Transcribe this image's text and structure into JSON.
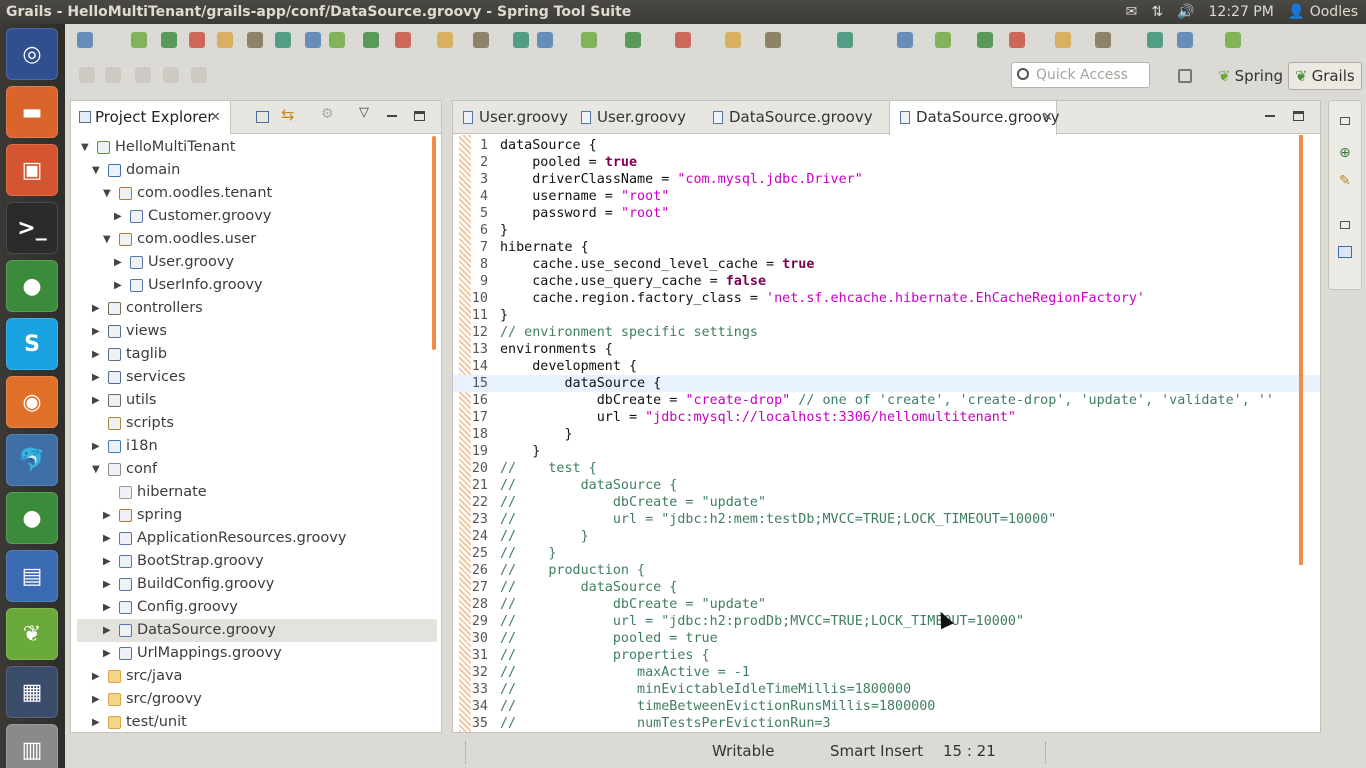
{
  "window": {
    "title": "Grails - HelloMultiTenant/grails-app/conf/DataSource.groovy - Spring Tool Suite"
  },
  "tray": {
    "time": "12:27 PM",
    "user": "Oodles"
  },
  "quick_access": {
    "placeholder": "Quick Access"
  },
  "perspectives": {
    "spring": "Spring",
    "grails": "Grails"
  },
  "project_explorer": {
    "title": "Project Explorer",
    "tree": [
      {
        "label": "HelloMultiTenant",
        "indent": 0,
        "twisty": "open",
        "icon": "project",
        "color": "#6a8f3a"
      },
      {
        "label": "domain",
        "indent": 1,
        "twisty": "open",
        "icon": "domain",
        "color": "#3d6fb0"
      },
      {
        "label": "com.oodles.tenant",
        "indent": 2,
        "twisty": "open",
        "icon": "package",
        "color": "#b07a2c"
      },
      {
        "label": "Customer.groovy",
        "indent": 3,
        "twisty": "closed",
        "icon": "file",
        "color": "#5677a6"
      },
      {
        "label": "com.oodles.user",
        "indent": 2,
        "twisty": "open",
        "icon": "package",
        "color": "#b07a2c"
      },
      {
        "label": "User.groovy",
        "indent": 3,
        "twisty": "closed",
        "icon": "file",
        "color": "#5677a6"
      },
      {
        "label": "UserInfo.groovy",
        "indent": 3,
        "twisty": "closed",
        "icon": "file",
        "color": "#5677a6"
      },
      {
        "label": "controllers",
        "indent": 1,
        "twisty": "closed",
        "icon": "controllers",
        "color": "#7a6b4e"
      },
      {
        "label": "views",
        "indent": 1,
        "twisty": "closed",
        "icon": "views",
        "color": "#5c6e86"
      },
      {
        "label": "taglib",
        "indent": 1,
        "twisty": "closed",
        "icon": "taglib",
        "color": "#5c6e86"
      },
      {
        "label": "services",
        "indent": 1,
        "twisty": "closed",
        "icon": "services",
        "color": "#4f6a8f"
      },
      {
        "label": "utils",
        "indent": 1,
        "twisty": "closed",
        "icon": "utils",
        "color": "#6b6b6b"
      },
      {
        "label": "scripts",
        "indent": 1,
        "twisty": "none",
        "icon": "scripts",
        "color": "#a08d3c"
      },
      {
        "label": "i18n",
        "indent": 1,
        "twisty": "closed",
        "icon": "globe",
        "color": "#3d7ab0"
      },
      {
        "label": "conf",
        "indent": 1,
        "twisty": "open",
        "icon": "conf",
        "color": "#8a8a8a"
      },
      {
        "label": "hibernate",
        "indent": 2,
        "twisty": "none",
        "icon": "package",
        "color": "#9a9a9a"
      },
      {
        "label": "spring",
        "indent": 2,
        "twisty": "closed",
        "icon": "package",
        "color": "#b07a2c"
      },
      {
        "label": "ApplicationResources.groovy",
        "indent": 2,
        "twisty": "closed",
        "icon": "file",
        "color": "#5677a6"
      },
      {
        "label": "BootStrap.groovy",
        "indent": 2,
        "twisty": "closed",
        "icon": "file",
        "color": "#5677a6"
      },
      {
        "label": "BuildConfig.groovy",
        "indent": 2,
        "twisty": "closed",
        "icon": "file",
        "color": "#5677a6"
      },
      {
        "label": "Config.groovy",
        "indent": 2,
        "twisty": "closed",
        "icon": "file",
        "color": "#5677a6"
      },
      {
        "label": "DataSource.groovy",
        "indent": 2,
        "twisty": "closed",
        "icon": "file",
        "color": "#5677a6",
        "selected": true
      },
      {
        "label": "UrlMappings.groovy",
        "indent": 2,
        "twisty": "closed",
        "icon": "file",
        "color": "#5677a6"
      },
      {
        "label": "src/java",
        "indent": 1,
        "twisty": "closed",
        "icon": "folder",
        "color": "#d9a441"
      },
      {
        "label": "src/groovy",
        "indent": 1,
        "twisty": "closed",
        "icon": "folder",
        "color": "#d9a441"
      },
      {
        "label": "test/unit",
        "indent": 1,
        "twisty": "closed",
        "icon": "folder",
        "color": "#d9a441"
      }
    ]
  },
  "editor": {
    "tabs": [
      {
        "label": "User.groovy",
        "active": false
      },
      {
        "label": "User.groovy",
        "active": false
      },
      {
        "label": "DataSource.groovy",
        "active": false
      },
      {
        "label": "DataSource.groovy",
        "active": true
      }
    ],
    "lines": [
      [
        {
          "t": "dataSource {",
          "c": "plain"
        }
      ],
      [
        {
          "t": "    pooled = ",
          "c": "plain"
        },
        {
          "t": "true",
          "c": "kw"
        }
      ],
      [
        {
          "t": "    driverClassName = ",
          "c": "plain"
        },
        {
          "t": "\"com.mysql.jdbc.Driver\"",
          "c": "str"
        }
      ],
      [
        {
          "t": "    username = ",
          "c": "plain"
        },
        {
          "t": "\"root\"",
          "c": "str"
        }
      ],
      [
        {
          "t": "    password = ",
          "c": "plain"
        },
        {
          "t": "\"root\"",
          "c": "str"
        }
      ],
      [
        {
          "t": "}",
          "c": "plain"
        }
      ],
      [
        {
          "t": "hibernate {",
          "c": "plain"
        }
      ],
      [
        {
          "t": "    cache.use_second_level_cache = ",
          "c": "plain"
        },
        {
          "t": "true",
          "c": "kw"
        }
      ],
      [
        {
          "t": "    cache.use_query_cache = ",
          "c": "plain"
        },
        {
          "t": "false",
          "c": "kw"
        }
      ],
      [
        {
          "t": "    cache.region.factory_class = ",
          "c": "plain"
        },
        {
          "t": "'net.sf.ehcache.hibernate.EhCacheRegionFactory'",
          "c": "str"
        }
      ],
      [
        {
          "t": "}",
          "c": "plain"
        }
      ],
      [
        {
          "t": "// environment specific settings",
          "c": "cm"
        }
      ],
      [
        {
          "t": "environments {",
          "c": "plain"
        }
      ],
      [
        {
          "t": "    development {",
          "c": "plain"
        }
      ],
      [
        {
          "t": "        dataSource {",
          "c": "plain"
        }
      ],
      [
        {
          "t": "            dbCreate = ",
          "c": "plain"
        },
        {
          "t": "\"create-drop\"",
          "c": "str"
        },
        {
          "t": " // one of 'create', 'create-drop', 'update', 'validate', ''",
          "c": "cm"
        }
      ],
      [
        {
          "t": "            url = ",
          "c": "plain"
        },
        {
          "t": "\"jdbc:mysql://localhost:3306/hellomultitenant\"",
          "c": "str"
        }
      ],
      [
        {
          "t": "        }",
          "c": "plain"
        }
      ],
      [
        {
          "t": "    }",
          "c": "plain"
        }
      ],
      [
        {
          "t": "//    test {",
          "c": "cm"
        }
      ],
      [
        {
          "t": "//        dataSource {",
          "c": "cm"
        }
      ],
      [
        {
          "t": "//            dbCreate = \"update\"",
          "c": "cm"
        }
      ],
      [
        {
          "t": "//            url = \"jdbc:h2:mem:testDb;MVCC=TRUE;LOCK_TIMEOUT=10000\"",
          "c": "cm"
        }
      ],
      [
        {
          "t": "//        }",
          "c": "cm"
        }
      ],
      [
        {
          "t": "//    }",
          "c": "cm"
        }
      ],
      [
        {
          "t": "//    production {",
          "c": "cm"
        }
      ],
      [
        {
          "t": "//        dataSource {",
          "c": "cm"
        }
      ],
      [
        {
          "t": "//            dbCreate = \"update\"",
          "c": "cm"
        }
      ],
      [
        {
          "t": "//            url = \"jdbc:h2:prodDb;MVCC=TRUE;LOCK_TIMEOUT=10000\"",
          "c": "cm"
        }
      ],
      [
        {
          "t": "//            pooled = true",
          "c": "cm"
        }
      ],
      [
        {
          "t": "//            properties {",
          "c": "cm"
        }
      ],
      [
        {
          "t": "//               maxActive = -1",
          "c": "cm"
        }
      ],
      [
        {
          "t": "//               minEvictableIdleTimeMillis=1800000",
          "c": "cm"
        }
      ],
      [
        {
          "t": "//               timeBetweenEvictionRunsMillis=1800000",
          "c": "cm"
        }
      ],
      [
        {
          "t": "//               numTestsPerEvictionRun=3",
          "c": "cm"
        }
      ]
    ],
    "current_line": 15
  },
  "status": {
    "writable": "Writable",
    "insert_mode": "Smart Insert",
    "position": "15 : 21"
  },
  "launcher": [
    {
      "name": "ubuntu-dash",
      "glyph": "◎",
      "color": "#2f4f8f"
    },
    {
      "name": "files",
      "glyph": "▬",
      "color": "#d9642c"
    },
    {
      "name": "software-center",
      "glyph": "▣",
      "color": "#d4552f"
    },
    {
      "name": "terminal",
      "glyph": ">_",
      "color": "#2b2b2b"
    },
    {
      "name": "chrome",
      "glyph": "●",
      "color": "#3b8b3b"
    },
    {
      "name": "skype",
      "glyph": "S",
      "color": "#1aa1e0"
    },
    {
      "name": "firefox",
      "glyph": "◉",
      "color": "#e0702a"
    },
    {
      "name": "mysql-workbench",
      "glyph": "🐬",
      "color": "#3f6fa6"
    },
    {
      "name": "chrome-2",
      "glyph": "●",
      "color": "#3b8b3b"
    },
    {
      "name": "libreoffice-writer",
      "glyph": "▤",
      "color": "#3a6ab0"
    },
    {
      "name": "spring-tool-suite",
      "glyph": "❦",
      "color": "#6aaa3a"
    },
    {
      "name": "workspace-switcher",
      "glyph": "▦",
      "color": "#3b4b6a"
    },
    {
      "name": "trash",
      "glyph": "▥",
      "color": "#8a8a8a"
    }
  ]
}
